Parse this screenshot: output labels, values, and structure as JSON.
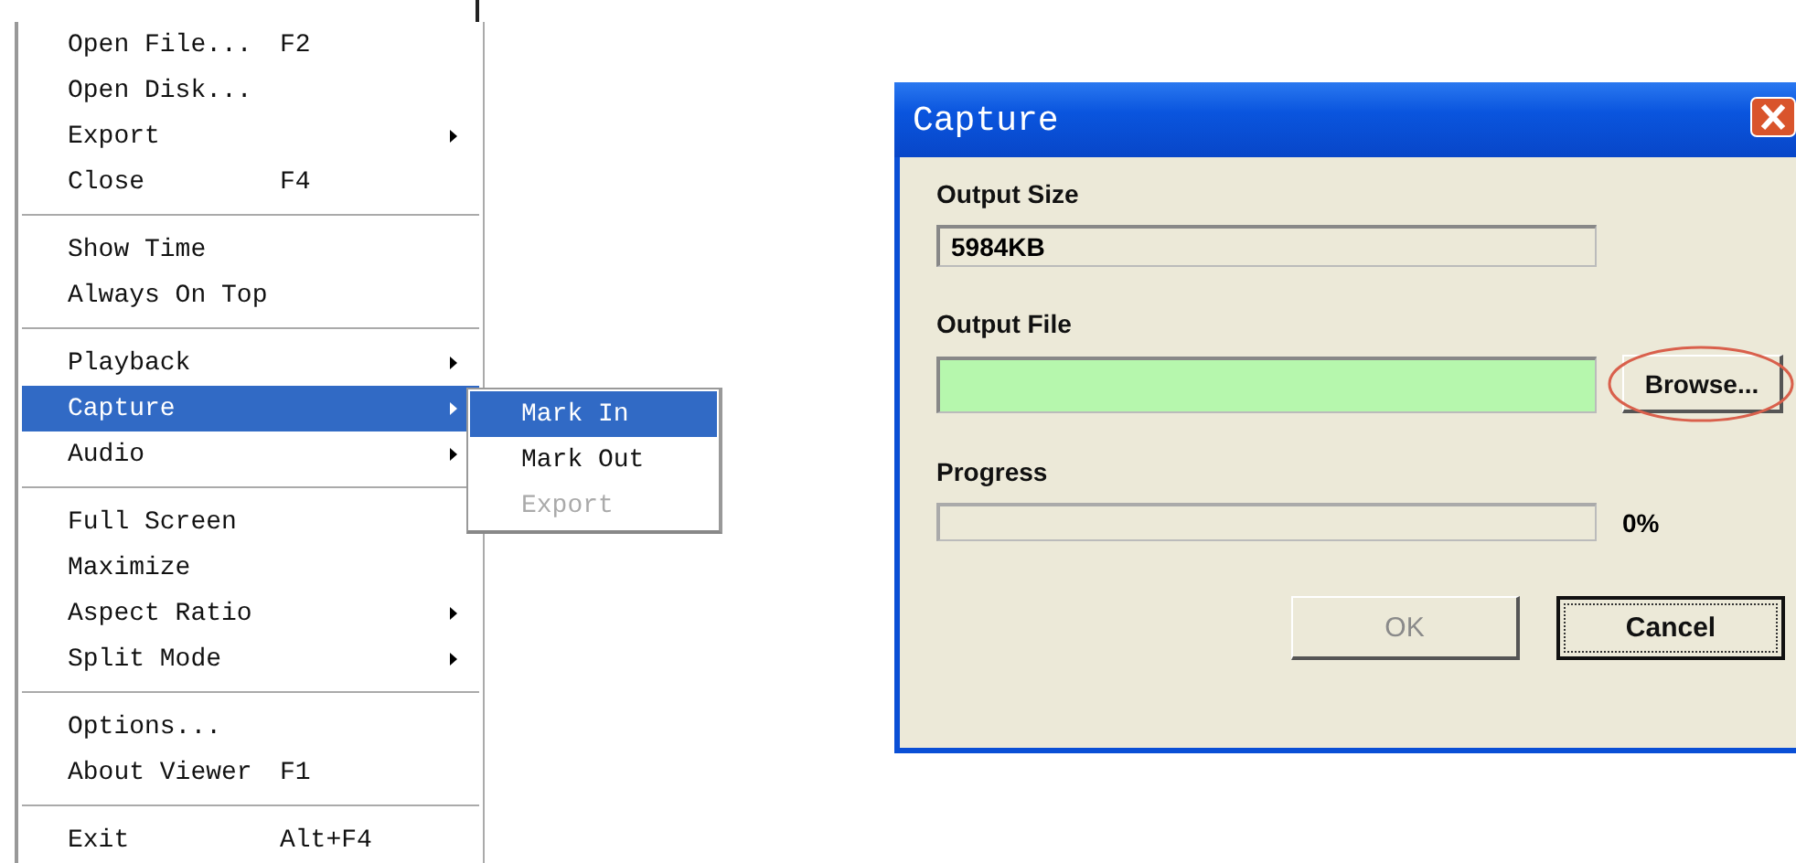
{
  "menu": {
    "items": [
      {
        "kind": "item",
        "label": "Open File...",
        "shortcut": "F2",
        "submenu": false,
        "selected": false
      },
      {
        "kind": "item",
        "label": "Open Disk...",
        "submenu": false,
        "selected": false
      },
      {
        "kind": "item",
        "label": "Export",
        "submenu": true,
        "selected": false
      },
      {
        "kind": "item",
        "label": "Close",
        "shortcut": "F4",
        "submenu": false,
        "selected": false
      },
      {
        "kind": "separator"
      },
      {
        "kind": "item",
        "label": "Show Time",
        "submenu": false,
        "selected": false
      },
      {
        "kind": "item",
        "label": "Always On Top",
        "submenu": false,
        "selected": false
      },
      {
        "kind": "separator"
      },
      {
        "kind": "item",
        "label": "Playback",
        "submenu": true,
        "selected": false
      },
      {
        "kind": "item",
        "label": "Capture",
        "submenu": true,
        "selected": true
      },
      {
        "kind": "item",
        "label": "Audio",
        "submenu": true,
        "selected": false
      },
      {
        "kind": "separator"
      },
      {
        "kind": "item",
        "label": "Full Screen",
        "submenu": false,
        "selected": false
      },
      {
        "kind": "item",
        "label": "Maximize",
        "submenu": false,
        "selected": false
      },
      {
        "kind": "item",
        "label": "Aspect Ratio",
        "submenu": true,
        "selected": false
      },
      {
        "kind": "item",
        "label": "Split Mode",
        "submenu": true,
        "selected": false
      },
      {
        "kind": "separator"
      },
      {
        "kind": "item",
        "label": "Options...",
        "submenu": false,
        "selected": false
      },
      {
        "kind": "item",
        "label": "About Viewer",
        "shortcut": "F1",
        "submenu": false,
        "selected": false
      },
      {
        "kind": "separator"
      },
      {
        "kind": "item",
        "label": "Exit",
        "shortcut": "Alt+F4",
        "submenu": false,
        "selected": false
      }
    ]
  },
  "submenu": {
    "items": [
      {
        "label": "Mark In",
        "selected": true,
        "disabled": false
      },
      {
        "label": "Mark Out",
        "selected": false,
        "disabled": false
      },
      {
        "label": "Export",
        "selected": false,
        "disabled": true
      }
    ]
  },
  "dialog": {
    "title": "Capture",
    "output_size": {
      "label": "Output Size",
      "value": "5984KB"
    },
    "output_file": {
      "label": "Output File",
      "browse": "Browse...",
      "browse_circled": true
    },
    "progress": {
      "label": "Progress",
      "level": 0,
      "reading": "0%"
    },
    "buttons": [
      {
        "label": "OK",
        "disabled": true,
        "default": false
      },
      {
        "label": "Cancel",
        "disabled": false,
        "default": true
      }
    ]
  }
}
